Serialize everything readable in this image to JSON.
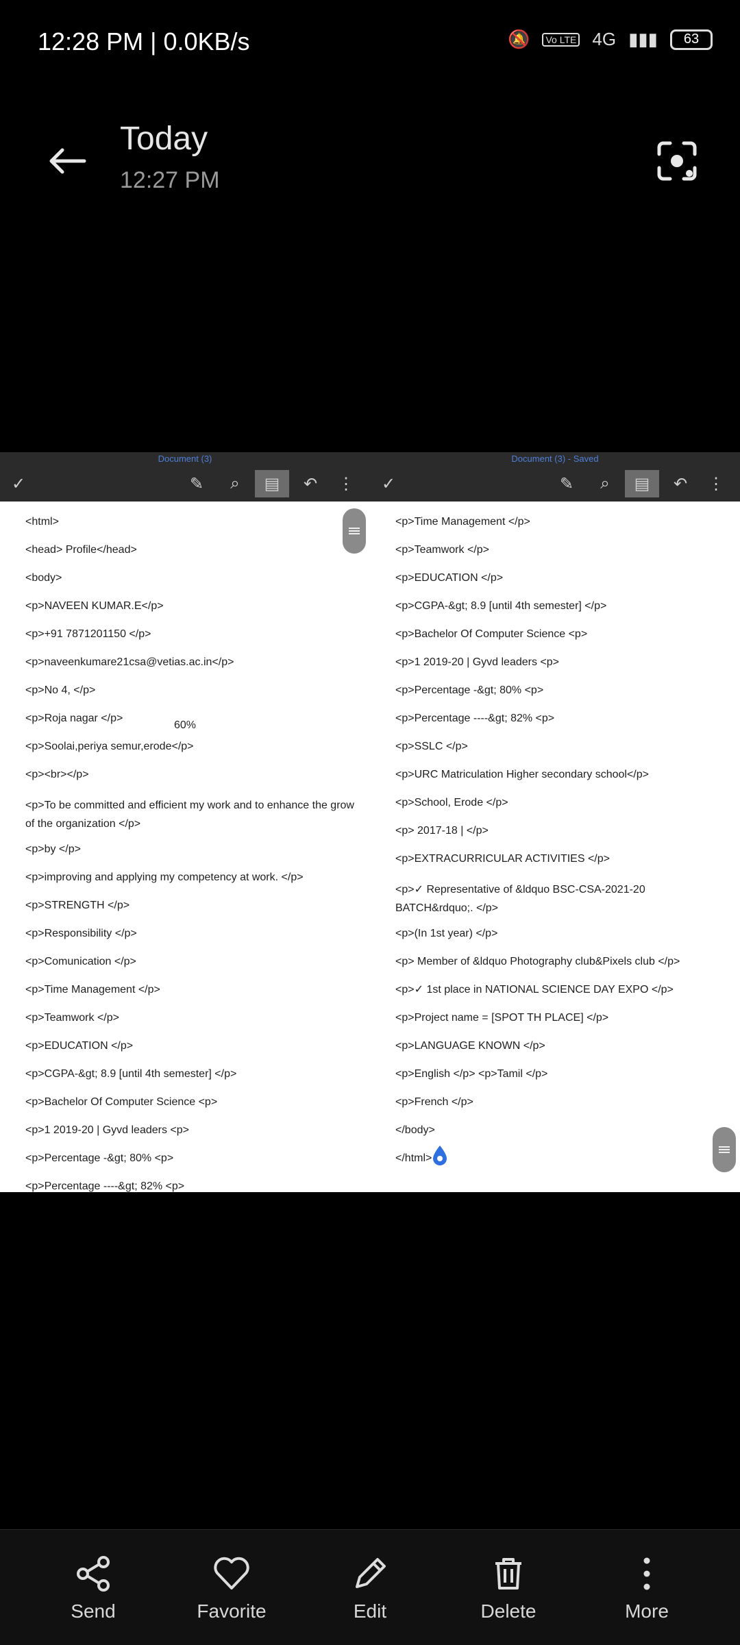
{
  "status_bar": {
    "time": "12:28 PM | 0.0KB/s",
    "network": "4G",
    "volte": "Vo LTE",
    "battery": "63"
  },
  "header": {
    "title": "Today",
    "subtitle": "12:27 PM"
  },
  "doc_left": {
    "name": "Document (3)",
    "zoom": "60%",
    "lines": [
      "<html>",
      "<head> Profile</head>",
      "<body>",
      "<p>NAVEEN KUMAR.E</p>",
      "<p>+91 7871201150 </p>",
      "<p>naveenkumare21csa@vetias.ac.in</p>",
      "<p>No 4, </p>",
      "<p>Roja nagar </p>",
      "<p>Soolai,periya semur,erode</p>",
      "<p><br></p>",
      "<p>To be committed and efficient my work and to enhance the grow of the organization </p>",
      "<p>by </p>",
      "<p>improving and applying my competency at work. </p>",
      "<p>STRENGTH </p>",
      "<p>Responsibility </p>",
      "<p>Comunication </p>",
      "<p>Time Management </p>",
      "<p>Teamwork </p>",
      "<p>EDUCATION </p>",
      "<p>CGPA-&gt; 8.9 [until 4th semester] </p>",
      "<p>Bachelor Of Computer Science <p>",
      "<p>1 2019-20 | Gyvd leaders <p>",
      "<p>Percentage -&gt; 80% <p>",
      "<p>Percentage ----&gt; 82% <p>"
    ]
  },
  "doc_right": {
    "name": "Document (3) - Saved",
    "lines": [
      "<p>Time Management </p>",
      "<p>Teamwork </p>",
      "<p>EDUCATION </p>",
      "<p>CGPA-&gt; 8.9 [until 4th semester] </p>",
      "<p>Bachelor Of Computer Science <p>",
      "<p>1 2019-20 | Gyvd leaders <p>",
      "<p>Percentage -&gt; 80% <p>",
      "<p>Percentage ----&gt; 82% <p>",
      "<p>SSLC </p>",
      "<p>URC Matriculation Higher secondary school</p>",
      "<p>School, Erode </p>",
      "<p> 2017-18 | </p>",
      "<p>EXTRACURRICULAR ACTIVITIES </p>",
      "<p>✓ Representative of &ldquo BSC-CSA-2021-20 BATCH&rdquo;. </p>",
      "<p>(In 1st year) </p>",
      "<p> Member of &ldquo Photography club&Pixels club </p>",
      "<p>✓ 1st place in NATIONAL SCIENCE DAY EXPO </p>",
      "<p>Project name = [SPOT TH PLACE] </p>",
      "<p>LANGUAGE KNOWN </p>",
      "<p>English </p> <p>Tamil </p>",
      "<p>French </p>",
      "</body>",
      "</html>"
    ]
  },
  "bottom_bar": {
    "send": "Send",
    "favorite": "Favorite",
    "edit": "Edit",
    "delete": "Delete",
    "more": "More"
  },
  "colors": {
    "background": "#000000",
    "doc_toolbar": "#2b2b2b",
    "doc_title": "#4f7fd8"
  },
  "icons": [
    "back-arrow-icon",
    "lens-icon",
    "share-icon",
    "heart-icon",
    "edit-pen-icon",
    "trash-icon",
    "more-vert-icon"
  ]
}
